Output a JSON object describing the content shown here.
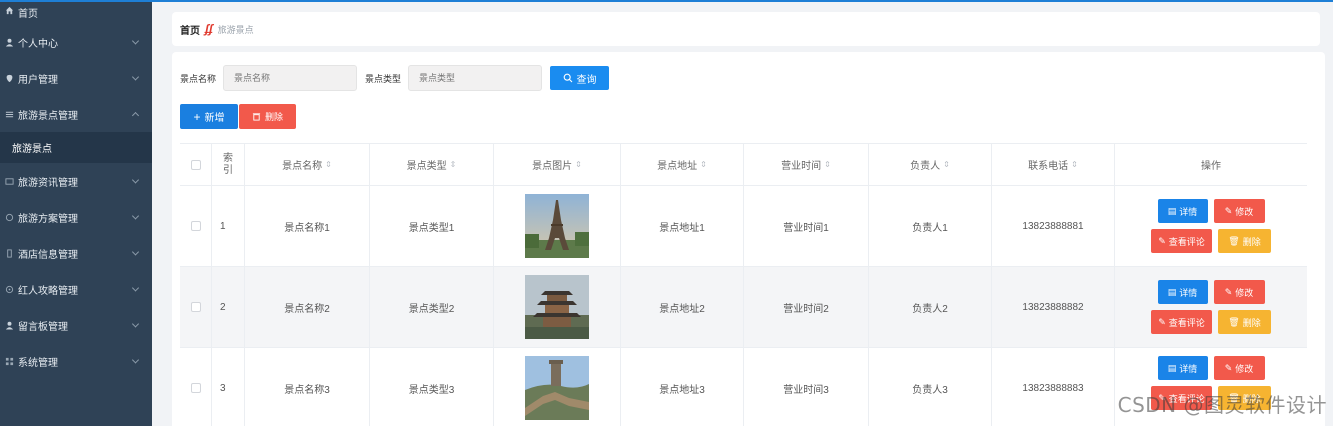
{
  "sidebar": {
    "items": [
      {
        "label": "首页",
        "icon": "home-icon"
      },
      {
        "label": "个人中心",
        "icon": "user-icon"
      },
      {
        "label": "用户管理",
        "icon": "user-manage-icon"
      },
      {
        "label": "旅游景点管理",
        "icon": "list-icon"
      },
      {
        "label": "旅游景点",
        "icon": ""
      },
      {
        "label": "旅游资讯管理",
        "icon": "news-icon"
      },
      {
        "label": "旅游方案管理",
        "icon": "plan-icon"
      },
      {
        "label": "酒店信息管理",
        "icon": "hotel-icon"
      },
      {
        "label": "红人攻略管理",
        "icon": "guide-icon"
      },
      {
        "label": "留言板管理",
        "icon": "message-icon"
      },
      {
        "label": "系统管理",
        "icon": "grid-icon"
      }
    ]
  },
  "breadcrumb": {
    "home": "首页",
    "current": "旅游景点"
  },
  "search": {
    "name_label": "景点名称",
    "name_placeholder": "景点名称",
    "type_label": "景点类型",
    "type_placeholder": "景点类型",
    "query_label": "查询"
  },
  "actions": {
    "add_label": "新增",
    "delete_label": "删除"
  },
  "table": {
    "headers": [
      "索引",
      "景点名称",
      "景点类型",
      "景点图片",
      "景点地址",
      "营业时间",
      "负责人",
      "联系电话",
      "操作"
    ],
    "rows": [
      {
        "index": "1",
        "name": "景点名称1",
        "type": "景点类型1",
        "photo": "eiffel-tower-photo",
        "address": "景点地址1",
        "hours": "营业时间1",
        "manager": "负责人1",
        "phone": "13823888881"
      },
      {
        "index": "2",
        "name": "景点名称2",
        "type": "景点类型2",
        "photo": "pagoda-photo",
        "address": "景点地址2",
        "hours": "营业时间2",
        "manager": "负责人2",
        "phone": "13823888882"
      },
      {
        "index": "3",
        "name": "景点名称3",
        "type": "景点类型3",
        "photo": "great-wall-photo",
        "address": "景点地址3",
        "hours": "营业时间3",
        "manager": "负责人3",
        "phone": "13823888883"
      }
    ],
    "row_buttons": {
      "detail": "详情",
      "edit": "修改",
      "review": "查看评论",
      "delete": "删除"
    }
  },
  "watermark": "CSDN @图灵软件设计",
  "colors": {
    "sidebar_bg": "#2f4256",
    "primary": "#1a8cf0",
    "danger": "#f2594b",
    "warning": "#f6b431"
  }
}
